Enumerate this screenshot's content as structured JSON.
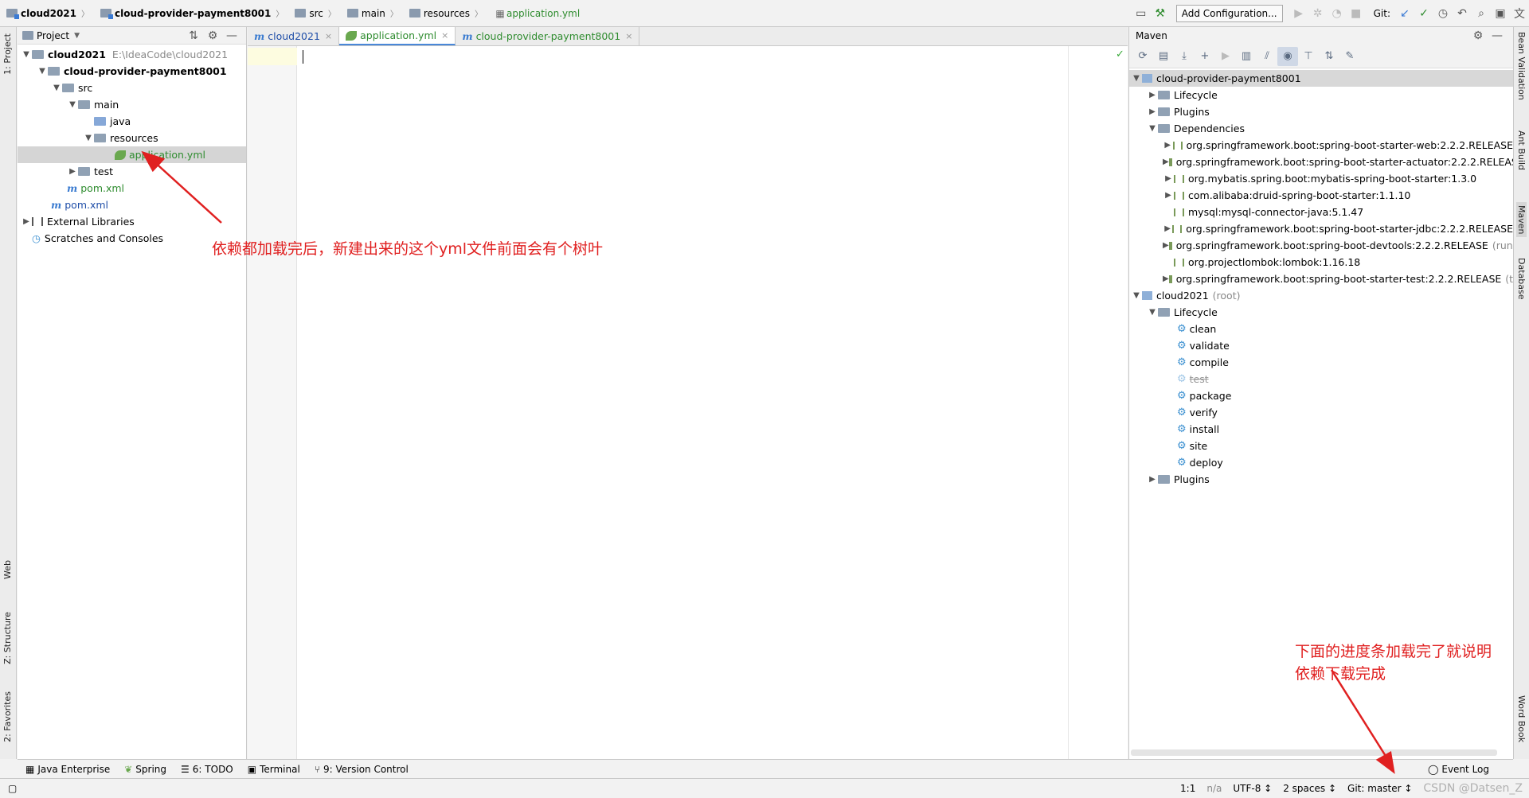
{
  "breadcrumb": {
    "items": [
      "cloud2021",
      "cloud-provider-payment8001",
      "src",
      "main",
      "resources",
      "application.yml"
    ]
  },
  "toolbar": {
    "add_config_label": "Add Configuration...",
    "git_label": "Git:"
  },
  "left_strip": {
    "project_tab": "1: Project",
    "web_tab": "Web",
    "structure_tab": "Z: Structure",
    "favorites_tab": "2: Favorites"
  },
  "right_strip": {
    "bean_tab": "Bean Validation",
    "ant_tab": "Ant Build",
    "maven_tab": "Maven",
    "database_tab": "Database",
    "wordbook_tab": "Word Book"
  },
  "project_panel": {
    "header": "Project",
    "tree": {
      "root": "cloud2021",
      "root_path": "E:\\IdeaCode\\cloud2021",
      "module": "cloud-provider-payment8001",
      "src": "src",
      "main": "main",
      "java": "java",
      "resources": "resources",
      "app_yml": "application.yml",
      "test": "test",
      "module_pom": "pom.xml",
      "root_pom": "pom.xml",
      "ext_libs": "External Libraries",
      "scratches": "Scratches and Consoles"
    }
  },
  "editor": {
    "tabs": [
      {
        "label": "cloud2021"
      },
      {
        "label": "application.yml"
      },
      {
        "label": "cloud-provider-payment8001"
      }
    ]
  },
  "maven": {
    "header": "Maven",
    "module": "cloud-provider-payment8001",
    "lifecycle": "Lifecycle",
    "plugins": "Plugins",
    "dependencies_label": "Dependencies",
    "dependencies": [
      "org.springframework.boot:spring-boot-starter-web:2.2.2.RELEASE",
      "org.springframework.boot:spring-boot-starter-actuator:2.2.2.RELEAS",
      "org.mybatis.spring.boot:mybatis-spring-boot-starter:1.3.0",
      "com.alibaba:druid-spring-boot-starter:1.1.10",
      "mysql:mysql-connector-java:5.1.47",
      "org.springframework.boot:spring-boot-starter-jdbc:2.2.2.RELEASE",
      "org.springframework.boot:spring-boot-devtools:2.2.2.RELEASE",
      "org.projectlombok:lombok:1.16.18",
      "org.springframework.boot:spring-boot-starter-test:2.2.2.RELEASE"
    ],
    "dep_suffixes": [
      "",
      "",
      "",
      "",
      "",
      "",
      "(runti",
      "",
      "(tes"
    ],
    "root": "cloud2021",
    "root_suffix": "(root)",
    "root_lifecycle": "Lifecycle",
    "goals": [
      "clean",
      "validate",
      "compile",
      "test",
      "package",
      "verify",
      "install",
      "site",
      "deploy"
    ],
    "root_plugins": "Plugins"
  },
  "bottom_tabs": [
    "Java Enterprise",
    "Spring",
    "6: TODO",
    "Terminal",
    "9: Version Control"
  ],
  "event_log": "Event Log",
  "status": {
    "position": "1:1",
    "na": "n/a",
    "encoding": "UTF-8 ↕",
    "indent": "2 spaces ↕",
    "git": "Git: master ↕",
    "watermark": "CSDN @Datsen_Z"
  },
  "annotations": {
    "left_note": "依赖都加载完后，新建出来的这个yml文件前面会有个树叶",
    "right_note_line1": "下面的进度条加载完了就说明",
    "right_note_line2": "依赖下载完成"
  },
  "colors": {
    "annotation": "#e02020",
    "accent": "#4a88d9",
    "yml_green": "#2f8c2f"
  }
}
